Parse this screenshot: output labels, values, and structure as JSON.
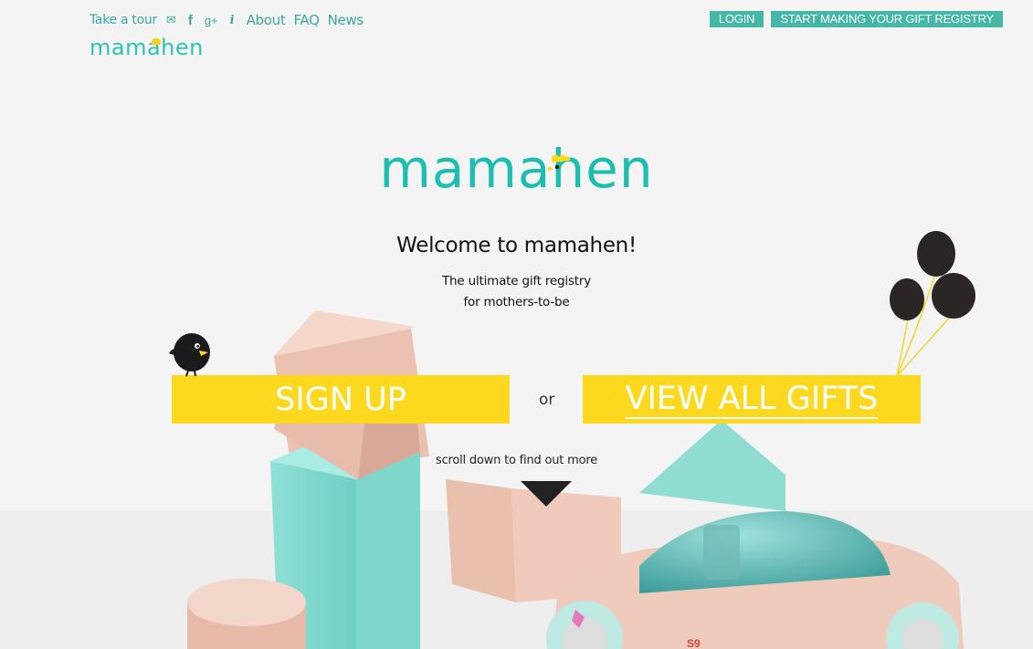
{
  "topnav": {
    "take_tour": "Take a tour",
    "email_glyph": "✉",
    "facebook_glyph": "f",
    "googleplus_glyph": "g+",
    "info_glyph": "i",
    "about": "About",
    "faq": "FAQ",
    "news": "News"
  },
  "brand": {
    "name": "mamahen"
  },
  "actions": {
    "login": "LOGIN",
    "start_registry": "START MAKING YOUR GIFT REGISTRY"
  },
  "hero": {
    "welcome": "Welcome to mamahen!",
    "tagline_line1": "The ultimate gift registry",
    "tagline_line2": "for mothers-to-be",
    "signup": "SIGN UP",
    "or": "or",
    "view_all": "VIEW ALL GIFTS",
    "scroll_hint": "scroll down to find out more"
  },
  "colors": {
    "teal": "#1cbeb0",
    "teal_button": "#45b7a7",
    "yellow": "#fcd91e",
    "background": "#f3f3f3"
  }
}
